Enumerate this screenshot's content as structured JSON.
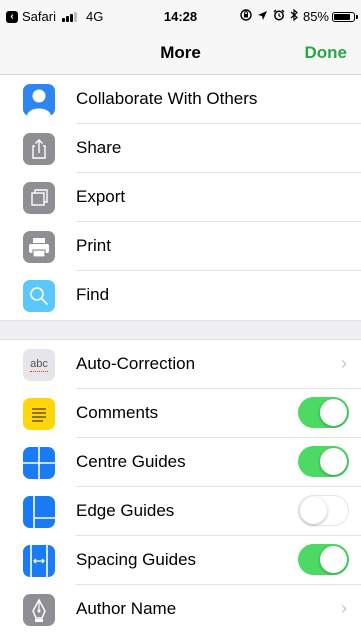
{
  "status_bar": {
    "back_app": "Safari",
    "network": "4G",
    "time": "14:28",
    "battery": "85%"
  },
  "nav": {
    "title": "More",
    "done_label": "Done",
    "accent_color": "#27a844"
  },
  "section1": [
    {
      "label": "Collaborate With Others",
      "icon": "person-icon",
      "icon_bg": "#2e86f0"
    },
    {
      "label": "Share",
      "icon": "share-icon",
      "icon_bg": "#8e8e93"
    },
    {
      "label": "Export",
      "icon": "export-icon",
      "icon_bg": "#8e8e93"
    },
    {
      "label": "Print",
      "icon": "printer-icon",
      "icon_bg": "#8e8e93"
    },
    {
      "label": "Find",
      "icon": "search-icon",
      "icon_bg": "#5ac8fa"
    }
  ],
  "section2": [
    {
      "label": "Auto-Correction",
      "icon": "abc-icon",
      "icon_text": "abc",
      "accessory": "chevron"
    },
    {
      "label": "Comments",
      "icon": "comments-icon",
      "icon_bg": "#ffd60a",
      "accessory": "toggle",
      "enabled": true
    },
    {
      "label": "Centre Guides",
      "icon": "centre-guides-icon",
      "icon_bg": "#1a7cf5",
      "accessory": "toggle",
      "enabled": true
    },
    {
      "label": "Edge Guides",
      "icon": "edge-guides-icon",
      "icon_bg": "#1a7cf5",
      "accessory": "toggle",
      "enabled": false
    },
    {
      "label": "Spacing Guides",
      "icon": "spacing-guides-icon",
      "icon_bg": "#1a7cf5",
      "accessory": "toggle",
      "enabled": true
    },
    {
      "label": "Author Name",
      "icon": "pen-nib-icon",
      "icon_bg": "#8e8e93",
      "accessory": "chevron"
    }
  ],
  "toggle_on_color": "#4cd964"
}
